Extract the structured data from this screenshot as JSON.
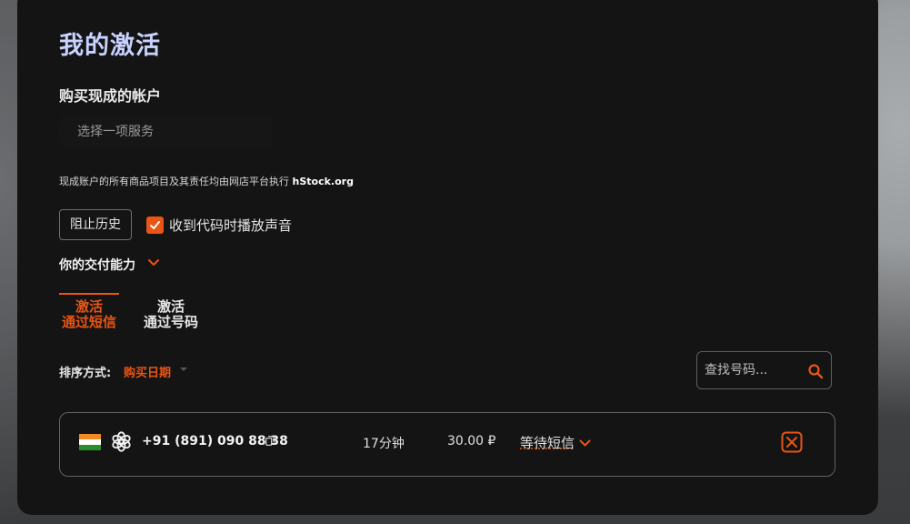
{
  "page": {
    "title": "我的激活",
    "subtitle": "购买现成的帐户",
    "service_select_placeholder": "选择一项服务",
    "notice": {
      "text": "现成账户的所有商品项目及其责任均由网店平台执行 ",
      "link": "hStock.org"
    },
    "block_history_label": "阻止历史",
    "sound_checkbox": {
      "label": "收到代码时播放声音",
      "checked": true
    },
    "delivery_label": "你的交付能力"
  },
  "tabs": [
    {
      "line1": "激活",
      "line2": "通过短信",
      "active": true
    },
    {
      "line1": "激活",
      "line2": "通过号码",
      "active": false
    }
  ],
  "sort": {
    "label": "排序方式:",
    "value": "购买日期"
  },
  "search": {
    "placeholder": "查找号码..."
  },
  "activations": [
    {
      "country_flag": "india-flag",
      "service_icon": "openai-icon",
      "phone": "+91 (891) 090 88 38",
      "time_left": "17分钟",
      "price": "30.00 ₽",
      "status": "等待短信"
    }
  ],
  "colors": {
    "accent": "#ea5514",
    "title": "#c8d2ff",
    "panel": "#141414"
  }
}
